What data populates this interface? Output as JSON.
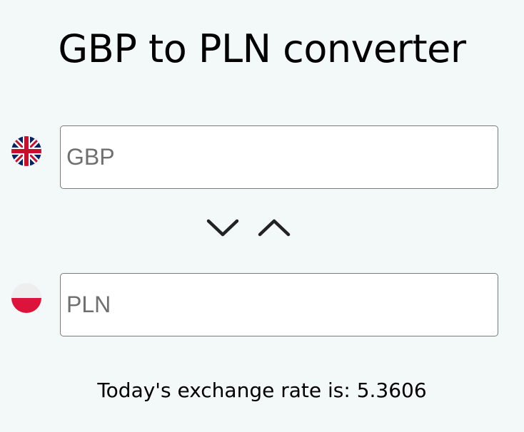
{
  "header": {
    "title": "GBP to PLN converter"
  },
  "converter": {
    "from": {
      "placeholder": "GBP",
      "value": "",
      "flag_icon": "uk-flag-icon"
    },
    "to": {
      "placeholder": "PLN",
      "value": "",
      "flag_icon": "poland-flag-icon"
    },
    "swap_icons": [
      "chevron-down-icon",
      "chevron-up-icon"
    ]
  },
  "rate": {
    "text": "Today's exchange rate is: 5.3606"
  },
  "colors": {
    "background": "#f3f8f9",
    "field_border": "#7a7a7a",
    "chevron": "#222222",
    "uk_blue": "#012169",
    "uk_red": "#C8102E",
    "pl_red": "#DC143C"
  }
}
